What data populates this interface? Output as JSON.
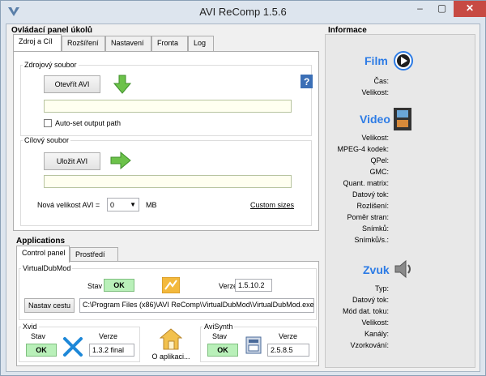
{
  "window": {
    "title": "AVI ReComp  1.5.6",
    "min": "–",
    "max": "▢",
    "close": "✕"
  },
  "tasks": {
    "title": "Ovládací panel úkolů",
    "tabs": [
      "Zdroj a Cíl",
      "Rozšíření",
      "Nastavení",
      "Fronta",
      "Log"
    ],
    "source": {
      "group": "Zdrojový soubor",
      "open_button": "Otevřít AVI",
      "path": "",
      "autoset_label": "Auto-set output path"
    },
    "target": {
      "group": "Cílový soubor",
      "save_button": "Uložit AVI",
      "path": "",
      "size_label": "Nová velikost AVI =",
      "size_value": "0",
      "size_unit": "MB",
      "custom_sizes": "Custom sizes"
    }
  },
  "applications": {
    "title": "Applications",
    "tabs": [
      "Control panel",
      "Prostředí"
    ],
    "virtualdubmod": {
      "group": "VirtualDubMod",
      "stav_label": "Stav",
      "stav_value": "OK",
      "verze_label": "Verze",
      "verze_value": "1.5.10.2",
      "path_button": "Nastav cestu",
      "path": "C:\\Program Files (x86)\\AVI ReComp\\VirtualDubMod\\VirtualDubMod.exe"
    },
    "xvid": {
      "group": "Xvid",
      "stav_label": "Stav",
      "stav_value": "OK",
      "verze_label": "Verze",
      "verze_value": "1.3.2 final"
    },
    "about": "O aplikaci...",
    "avisynth": {
      "group": "AviSynth",
      "stav_label": "Stav",
      "stav_value": "OK",
      "verze_label": "Verze",
      "verze_value": "2.5.8.5"
    }
  },
  "info": {
    "title": "Informace",
    "film": {
      "heading": "Film",
      "fields": [
        "Čas:",
        "Velikost:"
      ]
    },
    "video": {
      "heading": "Video",
      "fields": [
        "Velikost:",
        "MPEG-4 kodek:",
        "QPel:",
        "GMC:",
        "Quant. matrix:",
        "Datový tok:",
        "Rozlišení:",
        "Poměr stran:",
        "Snímků:",
        "Snímků/s.:"
      ]
    },
    "zvuk": {
      "heading": "Zvuk",
      "fields": [
        "Typ:",
        "Datový tok:",
        "Mód dat. toku:",
        "Velikost:",
        "Kanály:",
        "Vzorkování:"
      ]
    }
  }
}
